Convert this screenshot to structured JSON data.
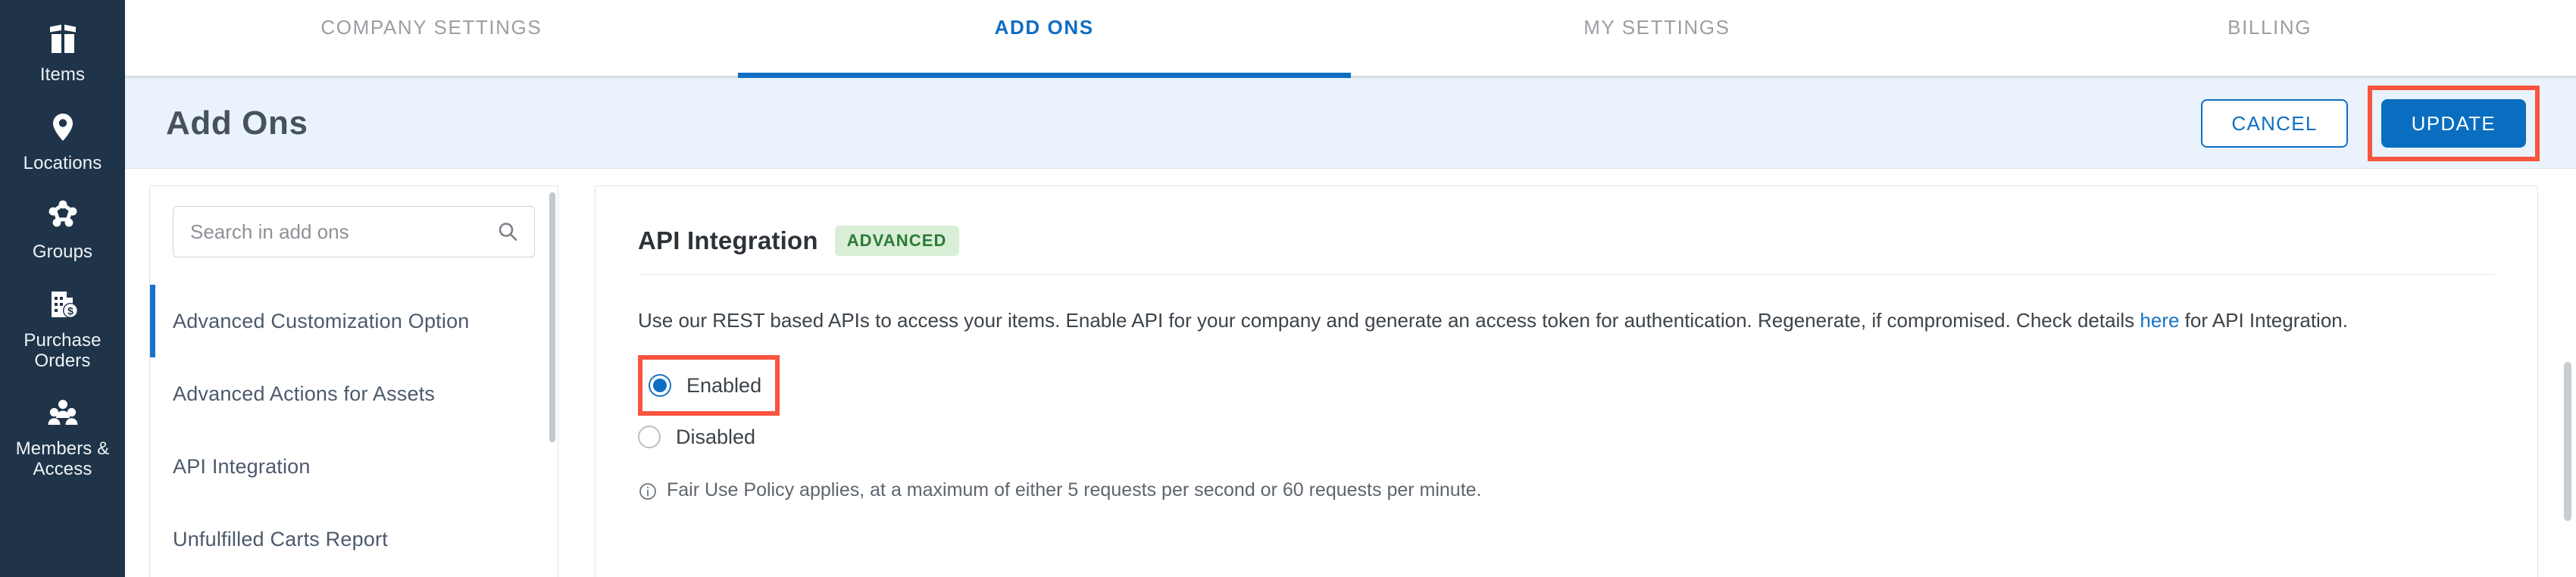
{
  "sidebar": {
    "items": [
      {
        "label": "Items",
        "icon": "items-icon"
      },
      {
        "label": "Locations",
        "icon": "location-pin-icon"
      },
      {
        "label": "Groups",
        "icon": "groups-icon"
      },
      {
        "label": "Purchase\nOrders",
        "icon": "purchase-order-icon"
      },
      {
        "label": "Members &\nAccess",
        "icon": "members-icon"
      }
    ]
  },
  "tabs": [
    {
      "label": "COMPANY SETTINGS",
      "active": false
    },
    {
      "label": "ADD ONS",
      "active": true
    },
    {
      "label": "MY SETTINGS",
      "active": false
    },
    {
      "label": "BILLING",
      "active": false
    }
  ],
  "header": {
    "title": "Add Ons",
    "cancel_label": "CANCEL",
    "update_label": "UPDATE"
  },
  "search": {
    "placeholder": "Search in add ons",
    "value": "",
    "icon": "search-icon"
  },
  "addons": [
    {
      "label": "Advanced Customization Option",
      "selected": true
    },
    {
      "label": "Advanced Actions for Assets",
      "selected": false
    },
    {
      "label": "API Integration",
      "selected": false
    },
    {
      "label": "Unfulfilled Carts Report",
      "selected": false
    }
  ],
  "detail": {
    "title": "API Integration",
    "badge": "ADVANCED",
    "description_before_link": "Use our REST based APIs to access your items. Enable API for your company and generate an access token for authentication. Regenerate, if compromised. Check details ",
    "description_link": "here",
    "description_after_link": " for API Integration.",
    "options": [
      {
        "label": "Enabled",
        "selected": true,
        "highlighted": true
      },
      {
        "label": "Disabled",
        "selected": false,
        "highlighted": false
      }
    ],
    "note_icon": "info-icon",
    "note": "Fair Use Policy applies, at a maximum of either 5 requests per second or 60 requests per minute."
  },
  "colors": {
    "rail_bg": "#1f3449",
    "accent_blue": "#0f6ec4",
    "highlight_red": "#f9543f",
    "header_band": "#eaf2fb",
    "badge_green_bg": "#d8eed6",
    "badge_green_text": "#2c7a35"
  }
}
